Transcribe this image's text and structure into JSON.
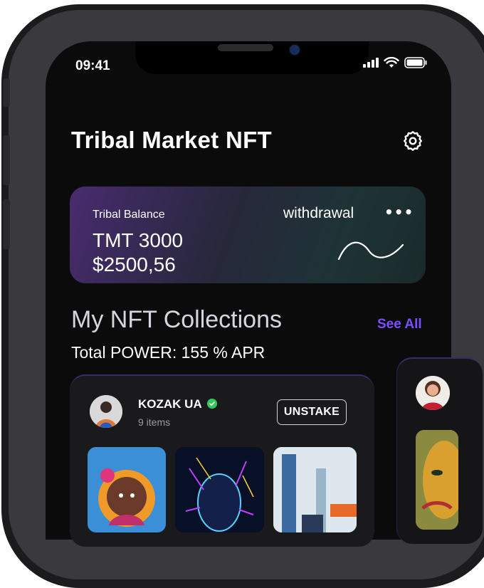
{
  "status_bar": {
    "time": "09:41"
  },
  "header": {
    "title": "Tribal Market NFT",
    "settings_icon": "gear-icon"
  },
  "balance": {
    "label": "Tribal Balance",
    "tmt": "TMT 3000",
    "usd": "$2500,56",
    "withdraw_label": "withdrawal",
    "more_label": "•••"
  },
  "collections": {
    "title": "My NFT Collections",
    "see_all": "See All",
    "power": "Total POWER: 155 % APR",
    "card": {
      "owner": "KOZAK UA",
      "items": "9 items",
      "unstake_label": "UNSTAKE"
    }
  },
  "colors": {
    "accent": "#7c4dff",
    "background": "#0b0b0c",
    "verified": "#34c759"
  }
}
